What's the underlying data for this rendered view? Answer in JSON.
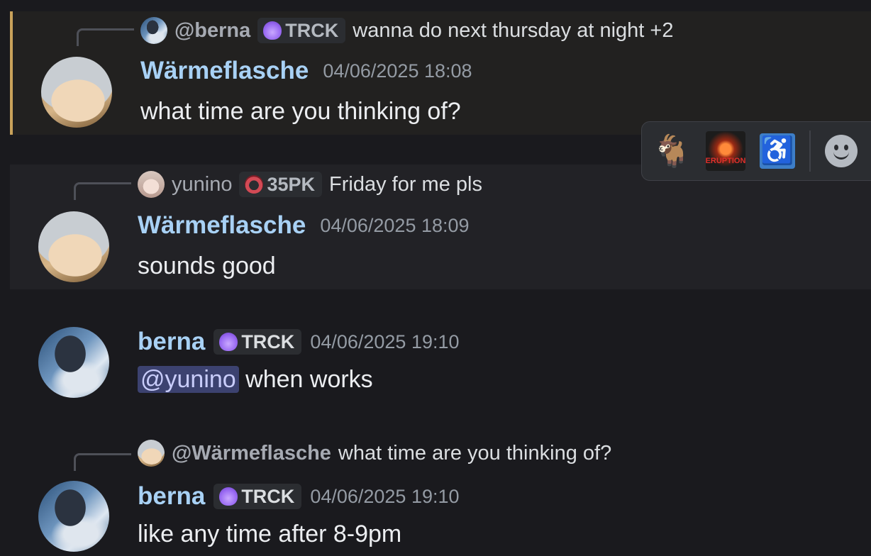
{
  "messages": [
    {
      "reply": {
        "author": "@berna",
        "tag": "TRCK",
        "text": "wanna do next thursday at night +2"
      },
      "author": "Wärmeflasche",
      "timestamp": "04/06/2025 18:08",
      "text": "what time are you thinking of?"
    },
    {
      "reply": {
        "author": "yunino",
        "tag": "35PK",
        "text": "Friday for me pls"
      },
      "author": "Wärmeflasche",
      "timestamp": "04/06/2025 18:09",
      "text": "sounds good"
    },
    {
      "author": "berna",
      "tag": "TRCK",
      "timestamp": "04/06/2025 19:10",
      "mention": "@yunino",
      "text": "when works"
    },
    {
      "reply": {
        "author": "@Wärmeflasche",
        "text": "what time are you thinking of?"
      },
      "author": "berna",
      "tag": "TRCK",
      "timestamp": "04/06/2025 19:10",
      "text": "like any time after 8-9pm"
    }
  ],
  "reaction_bar": {
    "icons": [
      "goat-emoji-icon",
      "eruption-emoji-icon",
      "wheelchair-emoji-icon",
      "add-reaction-icon"
    ],
    "eruption_label": "ERUPTION"
  },
  "colors": {
    "background": "#1a1a1e",
    "author": "#a8d1f5",
    "mention_highlight_border": "#c9a25a",
    "mention_pill": "#3c4270"
  }
}
